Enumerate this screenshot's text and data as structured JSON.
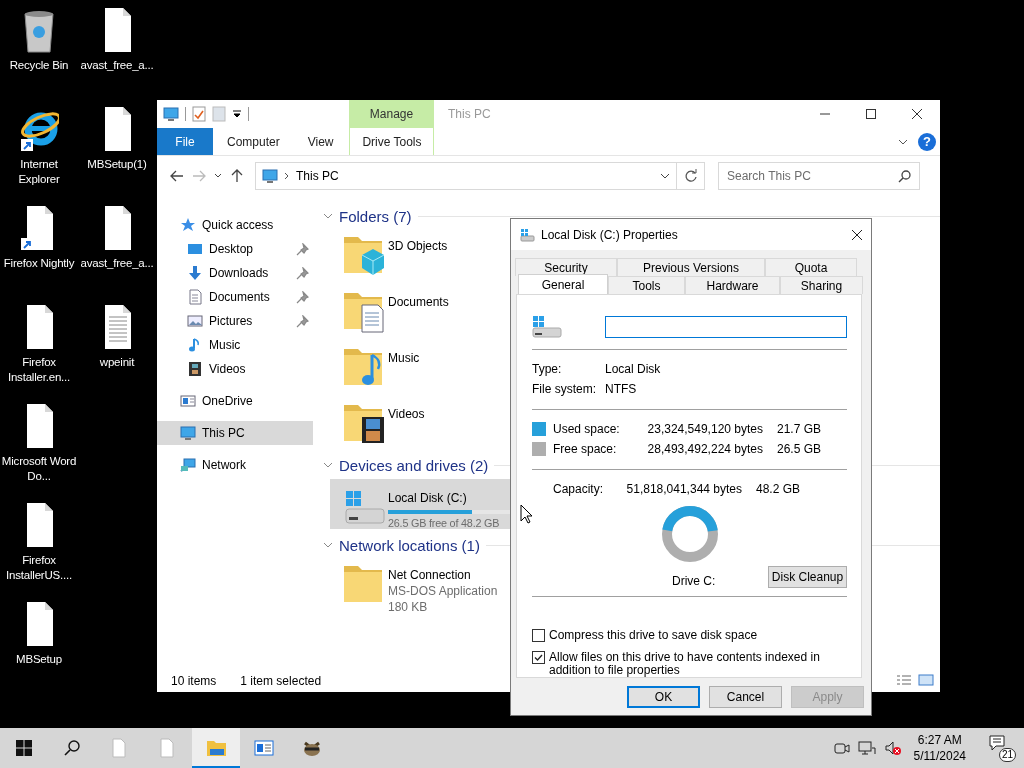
{
  "desktop_icons": [
    {
      "label": "Recycle Bin",
      "kind": "recycle",
      "shortcut": false
    },
    {
      "label": "Internet Explorer",
      "kind": "browser",
      "shortcut": true
    },
    {
      "label": "Firefox Nightly",
      "kind": "file",
      "shortcut": true
    },
    {
      "label": "Firefox Installer.en...",
      "kind": "file",
      "shortcut": false
    },
    {
      "label": "Microsoft Word Do...",
      "kind": "file",
      "shortcut": false
    },
    {
      "label": "Firefox InstallerUS....",
      "kind": "file",
      "shortcut": false
    },
    {
      "label": "MBSetup",
      "kind": "file",
      "shortcut": false
    },
    {
      "label": "avast_free_a...",
      "kind": "file",
      "shortcut": false
    },
    {
      "label": "MBSetup(1)",
      "kind": "file",
      "shortcut": false
    },
    {
      "label": "avast_free_a...",
      "kind": "file",
      "shortcut": false
    },
    {
      "label": "wpeinit",
      "kind": "text",
      "shortcut": false
    }
  ],
  "explorer": {
    "title": "This PC",
    "context_header": "Manage",
    "ribbon_tabs": [
      {
        "label": "File",
        "kind": "file",
        "selected": false
      },
      {
        "label": "Computer",
        "kind": "tab",
        "selected": false
      },
      {
        "label": "View",
        "kind": "tab",
        "selected": false
      },
      {
        "label": "Drive Tools",
        "kind": "context",
        "selected": false
      }
    ],
    "help": "?",
    "address": {
      "path": "This PC"
    },
    "search": {
      "placeholder": "Search This PC"
    },
    "nav": [
      {
        "label": "Quick access",
        "kind": "star",
        "selected": false,
        "children": [
          {
            "label": "Desktop",
            "kind": "desktop",
            "pinned": true,
            "selected": false
          },
          {
            "label": "Downloads",
            "kind": "download",
            "pinned": true,
            "selected": false
          },
          {
            "label": "Documents",
            "kind": "document",
            "pinned": true,
            "selected": false
          },
          {
            "label": "Pictures",
            "kind": "picture",
            "pinned": true,
            "selected": false
          },
          {
            "label": "Music",
            "kind": "music",
            "pinned": false,
            "selected": false
          },
          {
            "label": "Videos",
            "kind": "video",
            "pinned": false,
            "selected": false
          }
        ]
      },
      {
        "label": "OneDrive",
        "kind": "cloud",
        "selected": false
      },
      {
        "label": "This PC",
        "kind": "pc",
        "selected": true
      },
      {
        "label": "Network",
        "kind": "network",
        "selected": false
      }
    ],
    "groups": [
      {
        "title": "Folders (7)",
        "expanded": true,
        "items": [
          {
            "name": "3D Objects",
            "kind": "cube",
            "selected": false
          },
          {
            "name": "Documents",
            "kind": "document",
            "selected": false
          },
          {
            "name": "Music",
            "kind": "music",
            "selected": false
          },
          {
            "name": "Videos",
            "kind": "video",
            "selected": false
          }
        ]
      },
      {
        "title": "Devices and drives (2)",
        "expanded": true,
        "items": [
          {
            "name": "Local Disk (C:)",
            "kind": "drive",
            "selected": true,
            "level": 0.45,
            "details": [
              "26.5 GB free of 48.2 GB"
            ]
          }
        ]
      },
      {
        "title": "Network locations (1)",
        "expanded": true,
        "items": [
          {
            "name": "Net Connection",
            "kind": "app",
            "selected": false,
            "details": [
              "MS-DOS Application",
              "180 KB"
            ]
          }
        ]
      }
    ],
    "status": {
      "count": "10 items",
      "selection": "1 item selected"
    }
  },
  "properties": {
    "title": "Local Disk (C:) Properties",
    "tab_rows": [
      {
        "tabs": [
          {
            "label": "Security",
            "selected": false
          },
          {
            "label": "Previous Versions",
            "selected": false
          },
          {
            "label": "Quota",
            "selected": false
          }
        ]
      },
      {
        "tabs": [
          {
            "label": "General",
            "selected": true
          },
          {
            "label": "Tools",
            "selected": false
          },
          {
            "label": "Hardware",
            "selected": false
          },
          {
            "label": "Sharing",
            "selected": false
          }
        ]
      }
    ],
    "name_field": {
      "focused": true
    },
    "info": [
      {
        "label": "Type:",
        "value": "Local Disk"
      },
      {
        "label": "File system:",
        "value": "NTFS"
      }
    ],
    "spaces": [
      {
        "label": "Used space:",
        "bytes": "23,324,549,120 bytes",
        "size": "21.7 GB",
        "color": "#26a0da"
      },
      {
        "label": "Free space:",
        "bytes": "28,493,492,224 bytes",
        "size": "26.5 GB",
        "color": "#aeaeae"
      }
    ],
    "capacity": {
      "label": "Capacity:",
      "bytes": "51,818,041,344 bytes",
      "size": "48.2 GB"
    },
    "drive_label": "Drive C:",
    "cleanup_button": "Disk Cleanup",
    "options": [
      {
        "label": "Compress this drive to save disk space",
        "checked": false
      },
      {
        "label": "Allow files on this drive to have contents indexed in addition to file properties",
        "checked": true
      }
    ],
    "buttons": [
      {
        "label": "OK",
        "kind": "default",
        "disabled": false
      },
      {
        "label": "Cancel",
        "kind": "normal",
        "disabled": false
      },
      {
        "label": "Apply",
        "kind": "normal",
        "disabled": true
      }
    ]
  },
  "taskbar": {
    "apps": [
      {
        "kind": "file",
        "active": false
      },
      {
        "kind": "file",
        "active": false
      },
      {
        "kind": "folder",
        "active": true
      },
      {
        "kind": "window",
        "active": false
      },
      {
        "kind": "animal",
        "active": false
      }
    ],
    "clock": {
      "time": "6:27 AM",
      "date": "5/11/2024"
    },
    "notifications": "21"
  }
}
